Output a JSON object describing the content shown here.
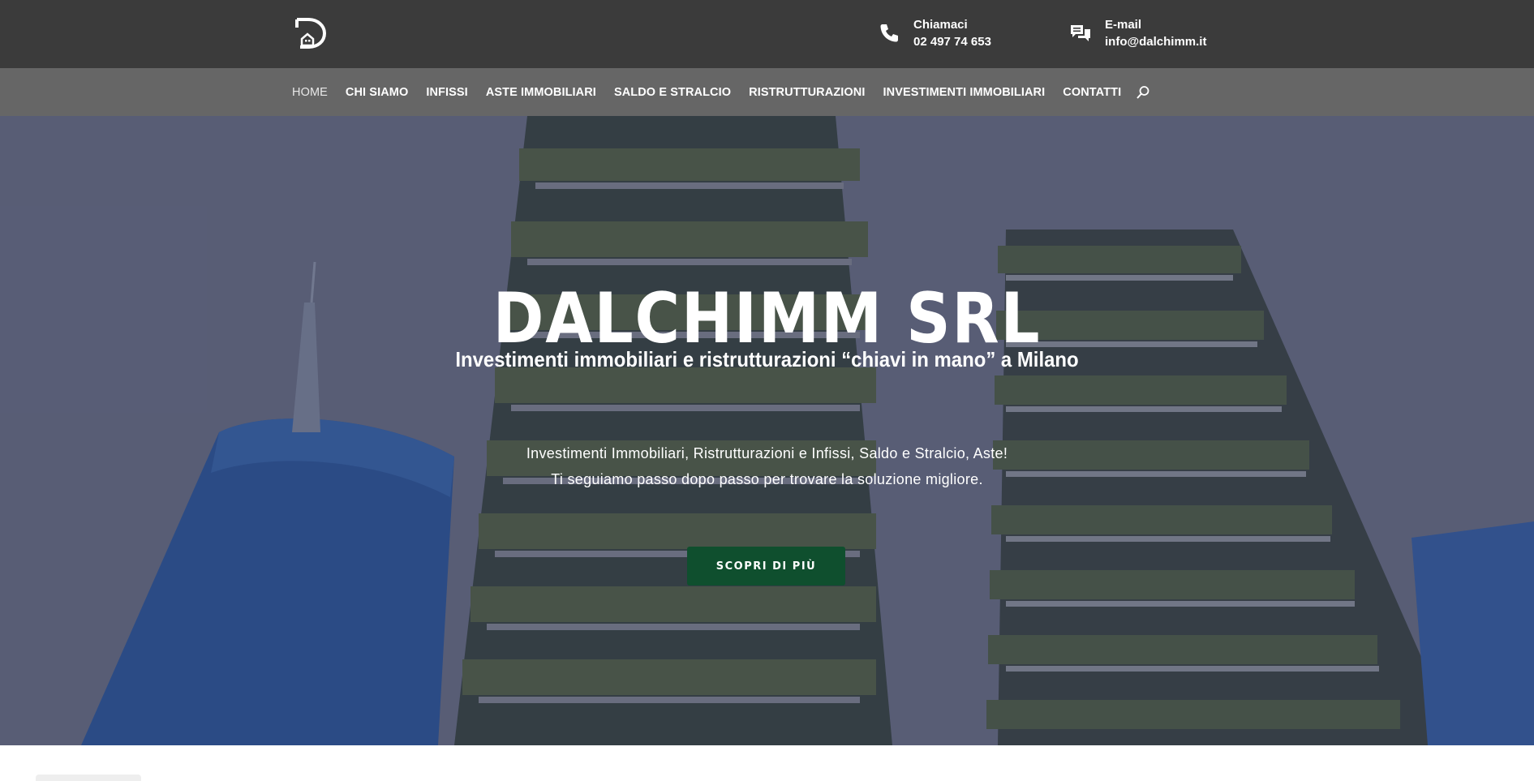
{
  "header": {
    "logo_icon": "dalchimm-logo-icon",
    "phone": {
      "icon": "phone-icon",
      "label": "Chiamaci",
      "value": "02 497 74 653"
    },
    "email": {
      "icon": "chat-icon",
      "label": "E-mail",
      "value": "info@dalchimm.it"
    }
  },
  "nav": {
    "items": [
      {
        "label": "HOME",
        "active": true
      },
      {
        "label": "CHI SIAMO"
      },
      {
        "label": "INFISSI"
      },
      {
        "label": "ASTE IMMOBILIARI"
      },
      {
        "label": "SALDO E STRALCIO"
      },
      {
        "label": "RISTRUTTURAZIONI"
      },
      {
        "label": "INVESTIMENTI IMMOBILIARI"
      },
      {
        "label": "CONTATTI"
      }
    ],
    "search_icon": "search-icon"
  },
  "hero": {
    "title": "DALCHIMM SRL",
    "subtitle": "Investimenti immobiliari e ristrutturazioni “chiavi in mano” a Milano",
    "text_line1": "Investimenti Immobiliari, Ristrutturazioni e Infissi, Saldo e Stralcio, Aste!",
    "text_line2": "Ti seguiamo passo dopo passo per trovare la soluzione migliore.",
    "button_label": "SCOPRI DI PIÙ"
  },
  "colors": {
    "topbar": "#3b3b3b",
    "navbar": "#666666",
    "button": "#0f4f2e"
  }
}
